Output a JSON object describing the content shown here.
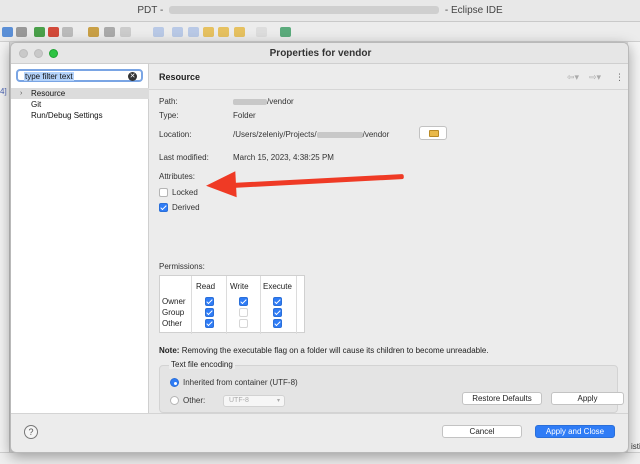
{
  "ide": {
    "title_prefix": "PDT -",
    "title_suffix": "- Eclipse IDE",
    "left_gutter": "4]",
    "right_edge": "istic"
  },
  "dialog": {
    "title": "Properties for vendor",
    "filter_placeholder": "type filter text",
    "tree": [
      "Resource",
      "Git",
      "Run/Debug Settings"
    ],
    "selected_tree_index": 0
  },
  "resource": {
    "page_title": "Resource",
    "path_label": "Path:",
    "path_value": "/vendor",
    "type_label": "Type:",
    "type_value": "Folder",
    "location_label": "Location:",
    "location_prefix": "/Users/zeleniy/Projects/",
    "location_suffix": "/vendor",
    "modified_label": "Last modified:",
    "modified_value": "March 15, 2023, 4:38:25 PM",
    "attributes_label": "Attributes:",
    "locked_label": "Locked",
    "locked_checked": false,
    "derived_label": "Derived",
    "derived_checked": true,
    "permissions_label": "Permissions:",
    "perm_headers": [
      "Read",
      "Write",
      "Execute"
    ],
    "perm_rows": [
      {
        "name": "Owner",
        "read": true,
        "write": true,
        "execute": true
      },
      {
        "name": "Group",
        "read": true,
        "write": false,
        "execute": true
      },
      {
        "name": "Other",
        "read": true,
        "write": false,
        "execute": true
      }
    ],
    "note_label": "Note:",
    "note_text": "Removing the executable flag on a folder will cause its children to become unreadable.",
    "encoding_title": "Text file encoding",
    "encoding_inherited": "Inherited from container (UTF-8)",
    "encoding_other": "Other:",
    "encoding_other_value": "UTF-8",
    "encoding_selected": "inherited"
  },
  "buttons": {
    "restore_defaults": "Restore Defaults",
    "apply": "Apply",
    "cancel": "Cancel",
    "apply_close": "Apply and Close",
    "help": "?"
  },
  "colors": {
    "accent": "#2f7cf6",
    "annotation_arrow": "#ef3a25",
    "zoom_button": "#2ec343"
  }
}
